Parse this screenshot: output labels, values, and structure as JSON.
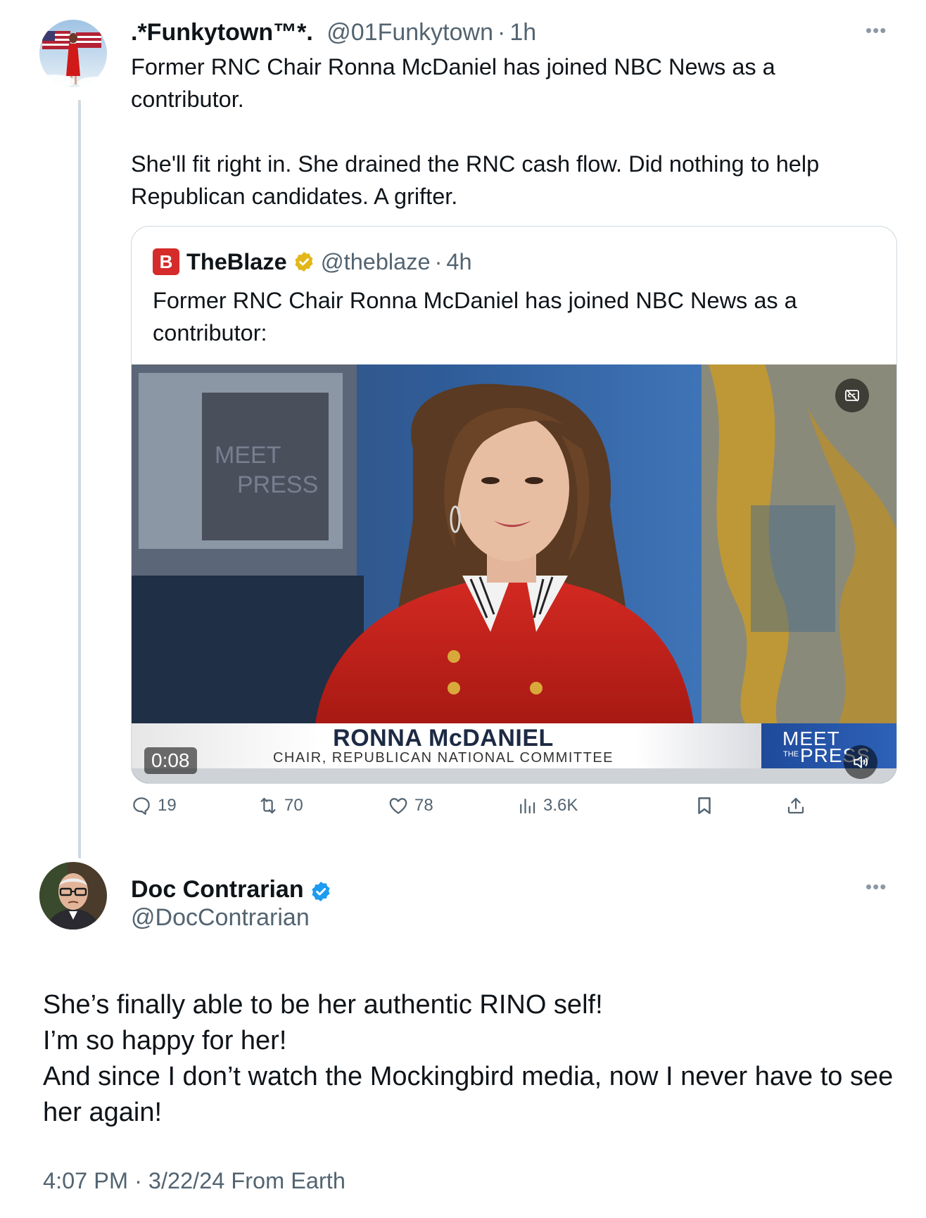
{
  "tweet1": {
    "display_name": ".*Funkytown™*.",
    "handle": "@01Funkytown",
    "separator": "·",
    "time": "1h",
    "more_icon": "more-horizontal-icon",
    "text_paragraphs": [
      "Former RNC Chair Ronna McDaniel has joined NBC News as a contributor.",
      "She'll fit right in.  She drained the RNC cash flow.  Did nothing to help Republican candidates.  A grifter."
    ]
  },
  "quote": {
    "logo_letter": "B",
    "display_name": "TheBlaze",
    "handle": "@theblaze",
    "separator": "·",
    "time": "4h",
    "text": "Former RNC Chair Ronna McDaniel has joined NBC News as a contributor:",
    "video": {
      "timestamp": "0:08",
      "lower_third_name": "RONNA McDANIEL",
      "lower_third_title": "CHAIR, REPUBLICAN NATIONAL COMMITTEE",
      "show_logo_line1": "MEET",
      "show_logo_line2": "PRESS",
      "show_logo_the": "THE",
      "background_logo_line1": "MEET",
      "background_logo_line2": "PRESS"
    }
  },
  "actions": {
    "replies": "19",
    "reposts": "70",
    "likes": "78",
    "views": "3.6K"
  },
  "tweet2": {
    "display_name": "Doc Contrarian",
    "handle": "@DocContrarian",
    "lines": [
      "She’s finally able to be her authentic RINO self!",
      "I’m so happy for her!",
      "And since I don’t watch the Mockingbird media, now I never have to see her again!"
    ],
    "footer": "4:07 PM · 3/22/24 From Earth"
  },
  "colors": {
    "text": "#0f1419",
    "secondary": "#536471",
    "verified_blue": "#1d9bf0",
    "verified_gold": "#e2b719",
    "blaze_red": "#d52b2b",
    "border": "#cfd9de"
  }
}
